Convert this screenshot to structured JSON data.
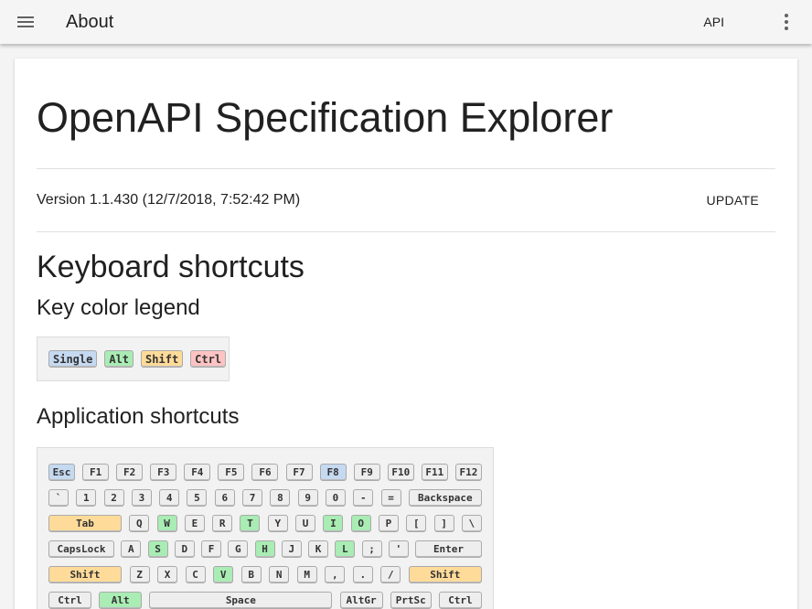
{
  "appbar": {
    "title": "About",
    "api_label": "API"
  },
  "main": {
    "title": "OpenAPI Specification Explorer",
    "version": "Version 1.1.430 (12/7/2018, 7:52:42 PM)",
    "update_label": "UPDATE",
    "shortcuts_title": "Keyboard shortcuts",
    "legend_title": "Key color legend",
    "legend": [
      "Single",
      "Alt",
      "Shift",
      "Ctrl"
    ],
    "app_shortcuts_title": "Application shortcuts"
  },
  "colors": {
    "single": "#c5d9f1",
    "alt": "#a9ecb4",
    "shift": "#ffdb99",
    "ctrl": "#ffc3c3",
    "key": "#eeeeee"
  },
  "keyboard": {
    "rows": [
      [
        [
          "Esc",
          "single"
        ],
        [
          "F1",
          ""
        ],
        [
          "F2",
          ""
        ],
        [
          "F3",
          ""
        ],
        [
          "F4",
          ""
        ],
        [
          "F5",
          ""
        ],
        [
          "F6",
          ""
        ],
        [
          "F7",
          ""
        ],
        [
          "F8",
          "single"
        ],
        [
          "F9",
          ""
        ],
        [
          "F10",
          ""
        ],
        [
          "F11",
          ""
        ],
        [
          "F12",
          ""
        ]
      ],
      [
        [
          "`",
          ""
        ],
        [
          "1",
          ""
        ],
        [
          "2",
          ""
        ],
        [
          "3",
          ""
        ],
        [
          "4",
          ""
        ],
        [
          "5",
          ""
        ],
        [
          "6",
          ""
        ],
        [
          "7",
          ""
        ],
        [
          "8",
          ""
        ],
        [
          "9",
          ""
        ],
        [
          "0",
          ""
        ],
        [
          "-",
          ""
        ],
        [
          "=",
          ""
        ],
        [
          "Backspace",
          ""
        ]
      ],
      [
        [
          "Tab",
          "shift"
        ],
        [
          "Q",
          ""
        ],
        [
          "W",
          "alt"
        ],
        [
          "E",
          ""
        ],
        [
          "R",
          ""
        ],
        [
          "T",
          "alt"
        ],
        [
          "Y",
          ""
        ],
        [
          "U",
          ""
        ],
        [
          "I",
          "alt"
        ],
        [
          "O",
          "alt"
        ],
        [
          "P",
          ""
        ],
        [
          "[",
          ""
        ],
        [
          "]",
          ""
        ],
        [
          "\\",
          ""
        ]
      ],
      [
        [
          "CapsLock",
          ""
        ],
        [
          "A",
          ""
        ],
        [
          "S",
          "alt"
        ],
        [
          "D",
          ""
        ],
        [
          "F",
          ""
        ],
        [
          "G",
          ""
        ],
        [
          "H",
          "alt"
        ],
        [
          "J",
          ""
        ],
        [
          "K",
          ""
        ],
        [
          "L",
          "alt"
        ],
        [
          ";",
          ""
        ],
        [
          "'",
          ""
        ],
        [
          "Enter",
          ""
        ]
      ],
      [
        [
          "Shift",
          "shift"
        ],
        [
          "Z",
          ""
        ],
        [
          "X",
          ""
        ],
        [
          "C",
          ""
        ],
        [
          "V",
          "alt"
        ],
        [
          "B",
          ""
        ],
        [
          "N",
          ""
        ],
        [
          "M",
          ""
        ],
        [
          ",",
          ""
        ],
        [
          ".",
          ""
        ],
        [
          "/",
          ""
        ],
        [
          "Shift",
          "shift"
        ]
      ],
      [
        [
          "Ctrl",
          ""
        ],
        [
          "Alt",
          "alt"
        ],
        [
          "Space",
          ""
        ],
        [
          "AltGr",
          ""
        ],
        [
          "PrtSc",
          ""
        ],
        [
          "Ctrl",
          ""
        ]
      ]
    ]
  }
}
